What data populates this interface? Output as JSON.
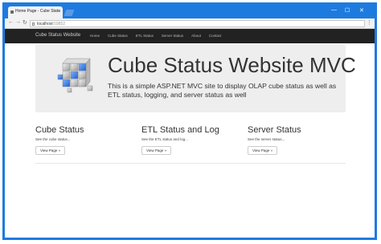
{
  "browser": {
    "tab_title": "Home Page - Cube Statu",
    "tab_close": "×",
    "url_host": "localhost",
    "url_port": ":59852",
    "back": "←",
    "forward": "→",
    "reload": "↻",
    "menu": "⋮",
    "minimize": "—",
    "maximize": "☐",
    "close": "✕"
  },
  "navbar": {
    "brand": "Cube Status Website",
    "links": [
      "Home",
      "Cube Status",
      "ETL Status",
      "Server Status",
      "About",
      "Contact"
    ]
  },
  "jumbotron": {
    "title": "Cube Status Website MVC",
    "lead": "This is a simple ASP.NET MVC site to display OLAP cube status as well as ETL status, logging, and server status as well",
    "logo_icon": "olap-cube-icon"
  },
  "columns": [
    {
      "heading": "Cube Status",
      "text": "See the cube status...",
      "button": "View Page »"
    },
    {
      "heading": "ETL Status and Log",
      "text": "See the ETL status and log...",
      "button": "View Page »"
    },
    {
      "heading": "Server Status",
      "text": "See the server status...",
      "button": "View Page »"
    }
  ],
  "colors": {
    "window_border": "#1d7be0",
    "navbar_bg": "#222222",
    "jumbotron_bg": "#eeeeee"
  }
}
